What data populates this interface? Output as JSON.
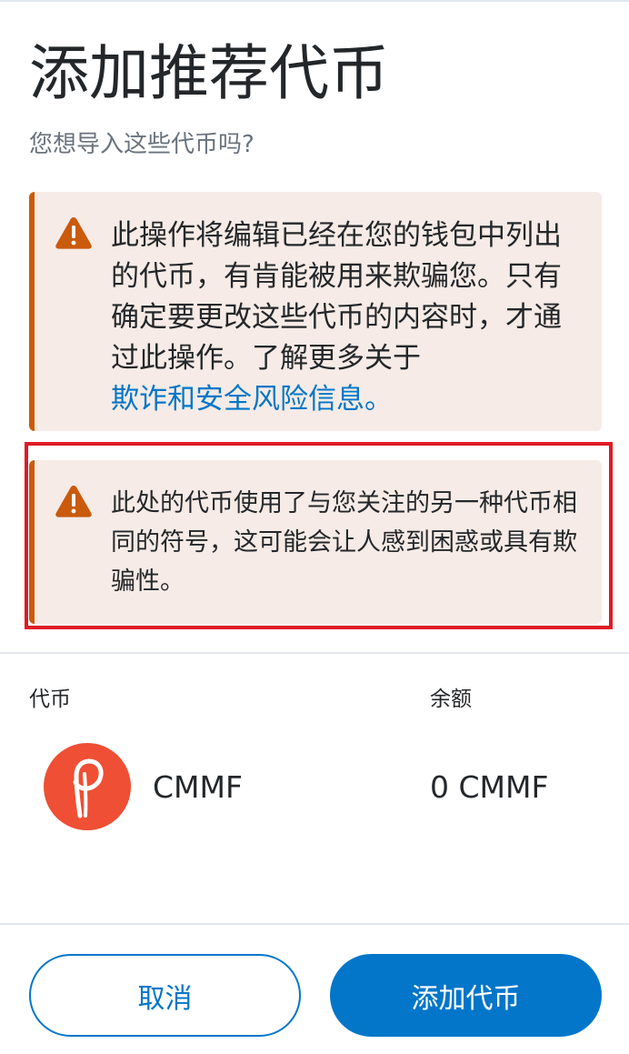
{
  "header": {
    "title": "添加推荐代币",
    "subtitle": "您想导入这些代币吗?"
  },
  "alerts": [
    {
      "icon": "warning-icon",
      "text": "此操作将编辑已经在您的钱包中列出的代币，有肯能被用来欺骗您。只有确定要更改这些代币的内容时，才通过此操作。了解更多关于",
      "link": "欺诈和安全风险信息。"
    },
    {
      "icon": "warning-icon",
      "text": "此处的代币使用了与您关注的另一种代币相同的符号，这可能会让人感到困惑或具有欺骗性。"
    }
  ],
  "table": {
    "headers": {
      "token": "代币",
      "balance": "余额"
    },
    "rows": [
      {
        "icon": "token-logo-icon",
        "symbol": "CMMF",
        "balance": "0 CMMF"
      }
    ]
  },
  "buttons": {
    "cancel": "取消",
    "add": "添加代币"
  },
  "colors": {
    "primary": "#0376c9",
    "warning": "#ca5a0c",
    "warning_bg": "#f6ebe6",
    "highlight": "#e01b24",
    "token_logo": "#ef4f34"
  }
}
